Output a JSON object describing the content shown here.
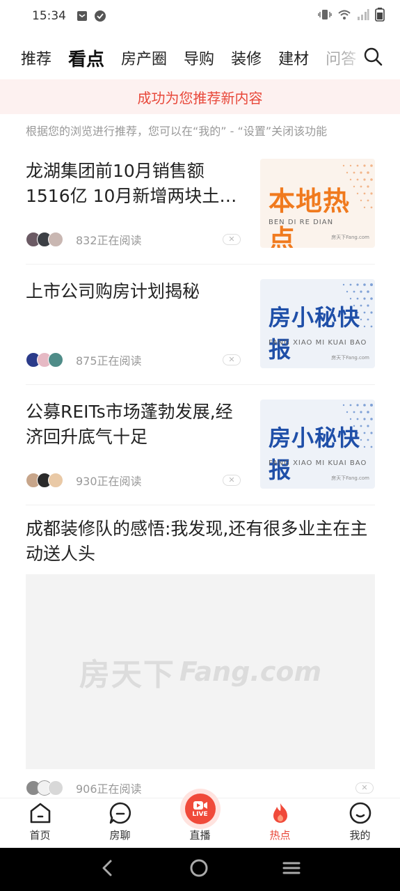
{
  "status_bar": {
    "time": "15:34"
  },
  "tabs": [
    {
      "label": "推荐",
      "active": false
    },
    {
      "label": "看点",
      "active": true
    },
    {
      "label": "房产圈",
      "active": false
    },
    {
      "label": "导购",
      "active": false
    },
    {
      "label": "装修",
      "active": false
    },
    {
      "label": "建材",
      "active": false
    },
    {
      "label": "问答",
      "active": false
    }
  ],
  "banner": {
    "text": "成功为您推荐新内容"
  },
  "hint": "根据您的浏览进行推荐，您可以在“我的” - “设置”关闭该功能",
  "feed": [
    {
      "title": "龙湖集团前10月销售额1516亿 10月新增两块土…",
      "reading": "832正在阅读",
      "thumb": {
        "big": "本地热点",
        "small": "BEN DI RE DIAN",
        "brand": "房天下Fang.com",
        "color": "#f07a1e"
      }
    },
    {
      "title": "上市公司购房计划揭秘",
      "reading": "875正在阅读",
      "thumb": {
        "big": "房小秘快报",
        "small": "FANG XIAO MI KUAI BAO",
        "brand": "房天下Fang.com",
        "color": "#1f4fa8"
      }
    },
    {
      "title": "公募REITs市场蓬勃发展,经济回升底气十足",
      "reading": "930正在阅读",
      "thumb": {
        "big": "房小秘快报",
        "small": "FANG XIAO MI KUAI BAO",
        "brand": "房天下Fang.com",
        "color": "#1f4fa8"
      }
    },
    {
      "title": "成都装修队的感悟:我发现,还有很多业主在主动送人头",
      "reading": "906正在阅读",
      "image_watermark_cn": "房天下",
      "image_watermark_en": "Fang.com"
    }
  ],
  "bottom_nav": [
    {
      "label": "首页",
      "icon": "home-icon",
      "active": false
    },
    {
      "label": "房聊",
      "icon": "chat-icon",
      "active": false
    },
    {
      "label": "直播",
      "icon": "live-icon",
      "active": false,
      "badge": "LIVE"
    },
    {
      "label": "热点",
      "icon": "flame-icon",
      "active": true
    },
    {
      "label": "我的",
      "icon": "profile-icon",
      "active": false
    }
  ],
  "colors": {
    "accent": "#e8483a",
    "banner_bg": "#fdf1f0"
  }
}
